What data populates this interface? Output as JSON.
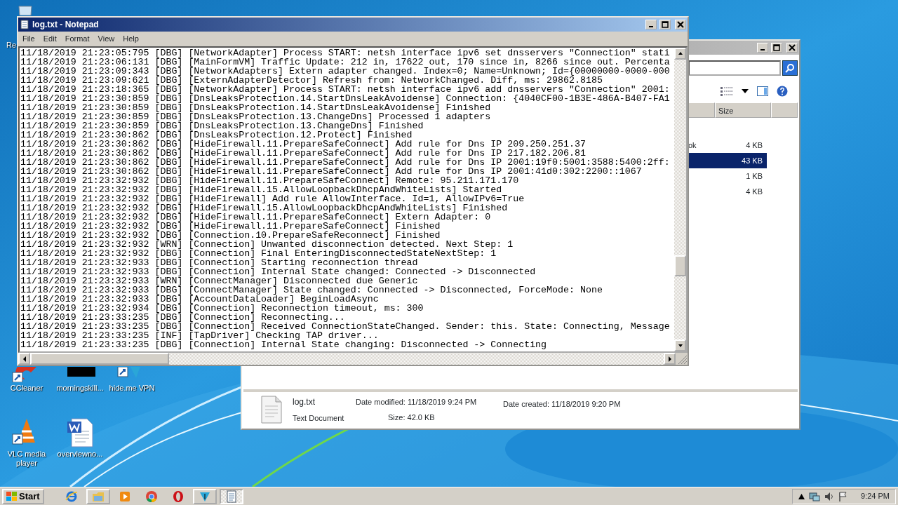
{
  "notepad": {
    "title": "log.txt - Notepad",
    "active": true,
    "menu": [
      "File",
      "Edit",
      "Format",
      "View",
      "Help"
    ],
    "lines": [
      "11/18/2019 21:23:05:795 [DBG] [NetworkAdapter] Process START: netsh interface ipv6 set dnsservers \"Connection\" stati",
      "11/18/2019 21:23:06:131 [DBG] [MainFormVM] Traffic Update: 212 in, 17622 out, 170 since in, 8266 since out. Percenta",
      "11/18/2019 21:23:09:343 [DBG] [NetworkAdapters] Extern adapter changed. Index=0; Name=Unknown; Id={00000000-0000-000",
      "11/18/2019 21:23:09:621 [DBG] [ExternAdapterDetector] Refresh from: NetworkChanged. Diff, ms: 29862.8185",
      "11/18/2019 21:23:18:365 [DBG] [NetworkAdapter] Process START: netsh interface ipv6 add dnsservers \"Connection\" 2001:",
      "11/18/2019 21:23:30:859 [DBG] [DnsLeaksProtection.14.StartDnsLeakAvoidense] Connection: {4040CF00-1B3E-486A-B407-FA1",
      "11/18/2019 21:23:30:859 [DBG] [DnsLeaksProtection.14.StartDnsLeakAvoidense] Finished",
      "11/18/2019 21:23:30:859 [DBG] [DnsLeaksProtection.13.ChangeDns] Processed 1 adapters",
      "11/18/2019 21:23:30:859 [DBG] [DnsLeaksProtection.13.ChangeDns] Finished",
      "11/18/2019 21:23:30:862 [DBG] [DnsLeaksProtection.12.Protect] Finished",
      "11/18/2019 21:23:30:862 [DBG] [HideFirewall.11.PrepareSafeConnect] Add rule for Dns IP 209.250.251.37",
      "11/18/2019 21:23:30:862 [DBG] [HideFirewall.11.PrepareSafeConnect] Add rule for Dns IP 217.182.206.81",
      "11/18/2019 21:23:30:862 [DBG] [HideFirewall.11.PrepareSafeConnect] Add rule for Dns IP 2001:19f0:5001:3588:5400:2ff:",
      "11/18/2019 21:23:30:862 [DBG] [HideFirewall.11.PrepareSafeConnect] Add rule for Dns IP 2001:41d0:302:2200::1067",
      "11/18/2019 21:23:32:932 [DBG] [HideFirewall.11.PrepareSafeConnect] Remote: 95.211.171.170",
      "11/18/2019 21:23:32:932 [DBG] [HideFirewall.15.AllowLoopbackDhcpAndWhiteLists] Started",
      "11/18/2019 21:23:32:932 [DBG] [HideFirewall] Add rule AllowInterface. Id=1, AllowIPv6=True",
      "11/18/2019 21:23:32:932 [DBG] [HideFirewall.15.AllowLoopbackDhcpAndWhiteLists] Finished",
      "11/18/2019 21:23:32:932 [DBG] [HideFirewall.11.PrepareSafeConnect] Extern Adapter: 0",
      "11/18/2019 21:23:32:932 [DBG] [HideFirewall.11.PrepareSafeConnect] Finished",
      "11/18/2019 21:23:32:932 [DBG] [Connection.10.PrepareSafeReconnect] Finished",
      "11/18/2019 21:23:32:932 [WRN] [Connection] Unwanted disconnection detected. Next Step: 1",
      "11/18/2019 21:23:32:932 [DBG] [Connection] Final EnteringDisconnectedStateNextStep: 1",
      "11/18/2019 21:23:32:933 [DBG] [Connection] Starting reconnection thread",
      "11/18/2019 21:23:32:933 [DBG] [Connection] Internal State changed: Connected -> Disconnected",
      "11/18/2019 21:23:32:933 [WRN] [ConnectManager] Disconnected due Generic",
      "11/18/2019 21:23:32:933 [DBG] [ConnectManager] State changed: Connected -> Disconnected, ForceMode: None",
      "11/18/2019 21:23:32:933 [DBG] [AccountDataLoader] BeginLoadAsync",
      "11/18/2019 21:23:32:934 [DBG] [Connection] Reconnection timeout, ms: 300",
      "11/18/2019 21:23:33:235 [DBG] [Connection] Reconnecting...",
      "11/18/2019 21:23:33:235 [DBG] [Connection] Received ConnectionStateChanged. Sender: this. State: Connecting, Message",
      "11/18/2019 21:23:33:235 [INF] [TapDriver] Checking TAP driver...",
      "11/18/2019 21:23:33:235 [DBG] [Connection] Internal State changing: Disconnected -> Connecting"
    ]
  },
  "explorer": {
    "active": false,
    "column": "Size",
    "rows": [
      {
        "name": "ok",
        "size": "4 KB",
        "selected": false
      },
      {
        "size": "43 KB",
        "selected": true
      },
      {
        "size": "1 KB",
        "selected": false
      },
      {
        "size": "4 KB",
        "selected": false
      }
    ],
    "details": {
      "name": "log.txt",
      "type": "Text Document",
      "modified": "Date modified: 11/18/2019 9:24 PM",
      "created": "Date created: 11/18/2019 9:20 PM",
      "size": "Size: 42.0 KB"
    }
  },
  "desktop_icons": [
    {
      "label": "Re",
      "kind": "bin"
    },
    {
      "label": "CCleaner",
      "kind": "ccleaner"
    },
    {
      "label": "morningskill...",
      "kind": "black"
    },
    {
      "label": "hide.me VPN",
      "kind": "vpn"
    },
    {
      "label": "VLC media player",
      "kind": "vlc"
    },
    {
      "label": "overviewno...",
      "kind": "word"
    }
  ],
  "taskbar": {
    "start": "Start",
    "items": [
      {
        "kind": "ie",
        "active": false
      },
      {
        "kind": "folder",
        "active": false
      },
      {
        "kind": "media",
        "active": false
      },
      {
        "kind": "chrome",
        "active": false
      },
      {
        "kind": "opera",
        "active": false
      },
      {
        "kind": "vpn",
        "active": false
      },
      {
        "kind": "notepad",
        "active": true
      }
    ],
    "clock": "9:24 PM"
  }
}
